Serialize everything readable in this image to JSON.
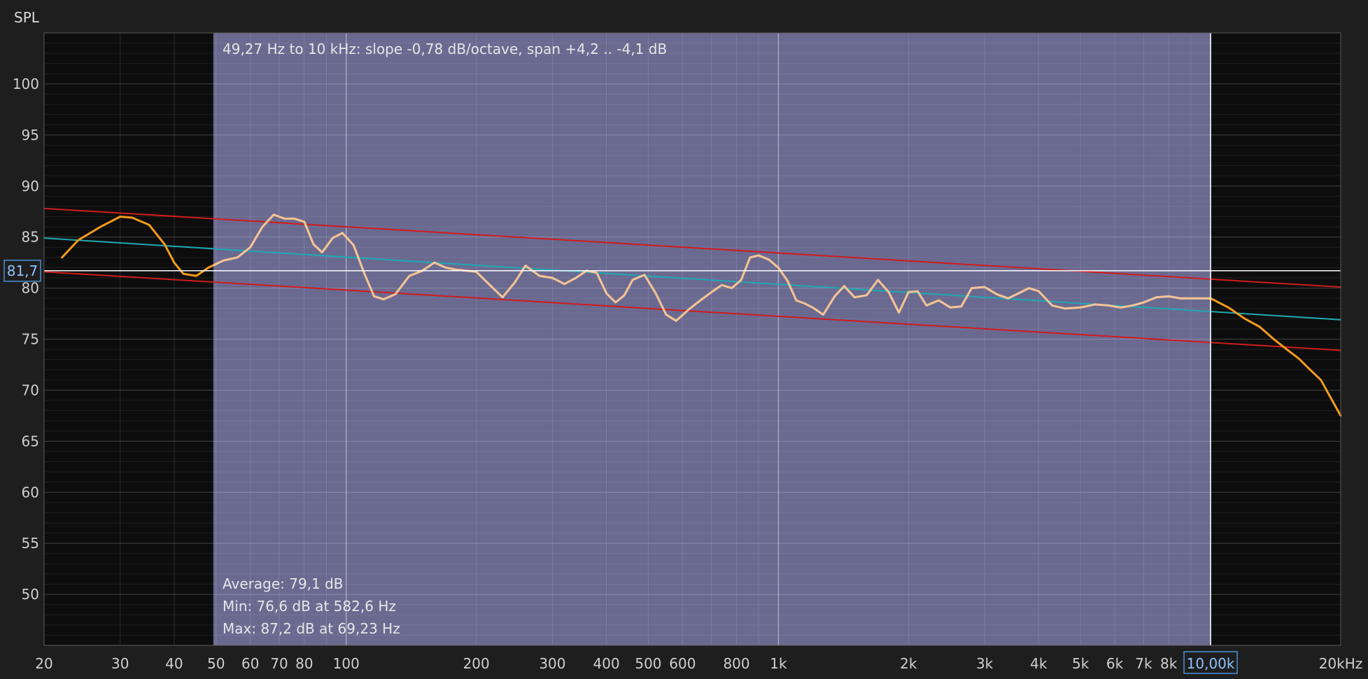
{
  "chart_data": {
    "type": "line",
    "ylabel": "SPL",
    "xscale": "log",
    "xlim": [
      20,
      20000
    ],
    "ylim": [
      45,
      105
    ],
    "grid": true,
    "x_ticks": [
      {
        "v": 20,
        "label": "20"
      },
      {
        "v": 30,
        "label": "30"
      },
      {
        "v": 40,
        "label": "40"
      },
      {
        "v": 50,
        "label": "50"
      },
      {
        "v": 60,
        "label": "60"
      },
      {
        "v": 70,
        "label": "70"
      },
      {
        "v": 80,
        "label": "80"
      },
      {
        "v": 100,
        "label": "100"
      },
      {
        "v": 200,
        "label": "200"
      },
      {
        "v": 300,
        "label": "300"
      },
      {
        "v": 400,
        "label": "400"
      },
      {
        "v": 500,
        "label": "500"
      },
      {
        "v": 600,
        "label": "600"
      },
      {
        "v": 800,
        "label": "800"
      },
      {
        "v": 1000,
        "label": "1k"
      },
      {
        "v": 2000,
        "label": "2k"
      },
      {
        "v": 3000,
        "label": "3k"
      },
      {
        "v": 4000,
        "label": "4k"
      },
      {
        "v": 5000,
        "label": "5k"
      },
      {
        "v": 6000,
        "label": "6k"
      },
      {
        "v": 7000,
        "label": "7k"
      },
      {
        "v": 8000,
        "label": "8k"
      },
      {
        "v": 20000,
        "label": "20kHz"
      }
    ],
    "y_ticks": [
      100,
      95,
      90,
      85,
      80,
      75,
      70,
      65,
      60,
      55,
      50
    ],
    "selection": {
      "from_hz": 49.27,
      "to_hz": 10000
    },
    "cursor": {
      "x_hz": 10000,
      "x_label": "10,00k",
      "y_db": 81.7,
      "y_label": "81,7"
    },
    "series": [
      {
        "color": "#f39a1e",
        "x": [
          22,
          24,
          27,
          30,
          32,
          35,
          38,
          40,
          42,
          45,
          48,
          52,
          56,
          60,
          64,
          68,
          72,
          76,
          80,
          84,
          88,
          93,
          98,
          104,
          110,
          116,
          122,
          130,
          140,
          150,
          160,
          170,
          180,
          190,
          200,
          215,
          230,
          245,
          260,
          280,
          300,
          320,
          340,
          360,
          380,
          400,
          420,
          440,
          460,
          490,
          520,
          550,
          580,
          620,
          660,
          700,
          740,
          780,
          820,
          860,
          900,
          950,
          1000,
          1050,
          1100,
          1150,
          1200,
          1270,
          1350,
          1420,
          1500,
          1600,
          1700,
          1800,
          1900,
          2000,
          2100,
          2200,
          2350,
          2500,
          2650,
          2800,
          3000,
          3200,
          3400,
          3600,
          3800,
          4000,
          4300,
          4600,
          5000,
          5400,
          5800,
          6200,
          6600,
          7000,
          7500,
          8000,
          8500,
          9000,
          10000,
          11000,
          12000,
          13000,
          14000,
          15000,
          16000,
          17000,
          18000,
          19000,
          20000
        ],
        "y": [
          83.0,
          84.7,
          86.0,
          87.0,
          86.9,
          86.2,
          84.3,
          82.5,
          81.4,
          81.2,
          82.0,
          82.7,
          83.0,
          84.0,
          86.0,
          87.2,
          86.8,
          86.8,
          86.5,
          84.3,
          83.5,
          84.9,
          85.4,
          84.2,
          81.5,
          79.2,
          78.9,
          79.4,
          81.2,
          81.7,
          82.5,
          82.0,
          81.8,
          81.7,
          81.6,
          80.3,
          79.1,
          80.5,
          82.2,
          81.2,
          81.0,
          80.4,
          81.0,
          81.7,
          81.5,
          79.5,
          78.6,
          79.3,
          80.8,
          81.3,
          79.5,
          77.4,
          76.8,
          77.9,
          78.8,
          79.6,
          80.3,
          80.0,
          80.8,
          83.0,
          83.2,
          82.8,
          82.0,
          80.7,
          78.8,
          78.5,
          78.1,
          77.4,
          79.2,
          80.2,
          79.1,
          79.3,
          80.8,
          79.6,
          77.6,
          79.6,
          79.7,
          78.3,
          78.8,
          78.1,
          78.2,
          80.0,
          80.1,
          79.4,
          79.0,
          79.5,
          80.0,
          79.7,
          78.3,
          78.0,
          78.1,
          78.4,
          78.3,
          78.1,
          78.3,
          78.6,
          79.1,
          79.2,
          79.0,
          79.0,
          79.0,
          78.1,
          77.0,
          76.2,
          75.0,
          74.0,
          73.1,
          72.0,
          71.0,
          69.2,
          67.5
        ]
      },
      {
        "color": "#1fa9b3",
        "x": [
          20,
          20000
        ],
        "y": [
          84.9,
          76.9
        ]
      },
      {
        "color": "#d01c1c",
        "x": [
          20,
          20000
        ],
        "y": [
          87.8,
          80.1
        ]
      },
      {
        "color": "#d01c1c",
        "x": [
          20,
          20000
        ],
        "y": [
          81.6,
          73.9
        ]
      }
    ],
    "annotations": {
      "top": "49,27 Hz to 10 kHz: slope -0,78 dB/octave, span +4,2 .. -4,1 dB",
      "average": "Average: 79,1 dB",
      "min": "Min: 76,6 dB at 582,6 Hz",
      "max": "Max: 87,2 dB at 69,23 Hz"
    }
  }
}
